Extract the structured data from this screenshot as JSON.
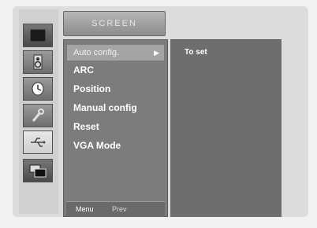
{
  "menu_title": "SCREEN",
  "rail_icons": [
    {
      "name": "picture-icon",
      "active": true
    },
    {
      "name": "speaker-icon",
      "active": false
    },
    {
      "name": "clock-icon",
      "active": false
    },
    {
      "name": "wrench-icon",
      "active": false
    },
    {
      "name": "usb-icon",
      "active": false
    },
    {
      "name": "screen-icon",
      "active": true
    }
  ],
  "menu_items": [
    {
      "label": "Auto config.",
      "selected": true
    },
    {
      "label": "ARC",
      "selected": false
    },
    {
      "label": "Position",
      "selected": false
    },
    {
      "label": "Manual config",
      "selected": false
    },
    {
      "label": "Reset",
      "selected": false
    },
    {
      "label": "VGA Mode",
      "selected": false
    }
  ],
  "selected_arrow": "▶",
  "submenu_value": "To set",
  "footer": {
    "menu": "Menu",
    "prev": "Prev"
  }
}
